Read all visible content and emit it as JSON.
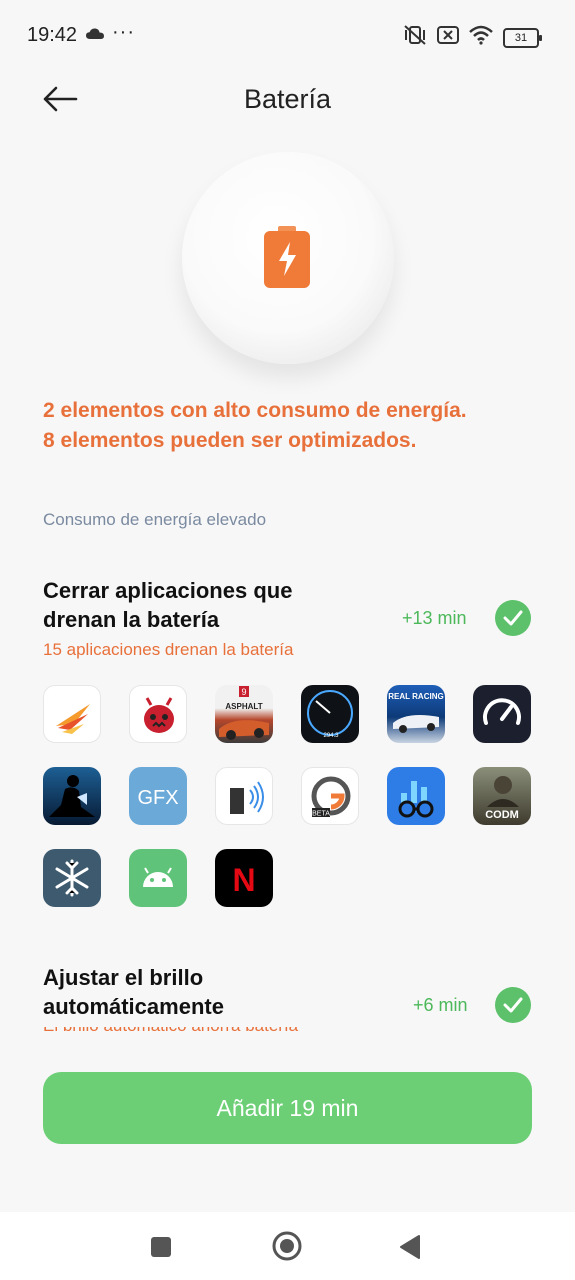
{
  "status_bar": {
    "time": "19:42",
    "dots": "···",
    "battery": "31"
  },
  "header": {
    "title": "Batería"
  },
  "summary": {
    "line1": "2 elementos con alto consumo de energía.",
    "line2": "8 elementos pueden ser optimizados."
  },
  "section": {
    "label": "Consumo de energía elevado"
  },
  "item1": {
    "title_line1": "Cerrar aplicaciones que",
    "title_line2": "drenan la batería",
    "subtitle": "15 aplicaciones drenan la batería",
    "gain": "+13 min",
    "checked": true
  },
  "apps": [
    {
      "name": "swift-app-icon"
    },
    {
      "name": "antutu-app-icon"
    },
    {
      "name": "asphalt-9-app-icon",
      "text": "ASPHALT"
    },
    {
      "name": "speedometer-app-icon",
      "text": "294.3"
    },
    {
      "name": "real-racing-app-icon",
      "text": "REAL RACING"
    },
    {
      "name": "speedtest-app-icon"
    },
    {
      "name": "kindle-app-icon"
    },
    {
      "name": "gfx-tool-app-icon",
      "text": "GFX"
    },
    {
      "name": "nfc-app-icon"
    },
    {
      "name": "gamebench-beta-app-icon",
      "text": "BETA"
    },
    {
      "name": "geekbench-app-icon"
    },
    {
      "name": "codm-app-icon",
      "text": "CODM"
    },
    {
      "name": "snowflake-app-icon"
    },
    {
      "name": "android-app-icon"
    },
    {
      "name": "netflix-app-icon",
      "text": "N"
    }
  ],
  "item2": {
    "title_line1": "Ajustar el brillo",
    "title_line2": "automáticamente",
    "subtitle": "El brillo automático ahorra batería",
    "gain": "+6 min",
    "checked": true
  },
  "cta": {
    "label": "Añadir 19 min"
  },
  "colors": {
    "accent_orange": "#e8703a",
    "green": "#5cc16a",
    "button_green": "#6ccf76",
    "label_gray": "#7a8aa0"
  }
}
